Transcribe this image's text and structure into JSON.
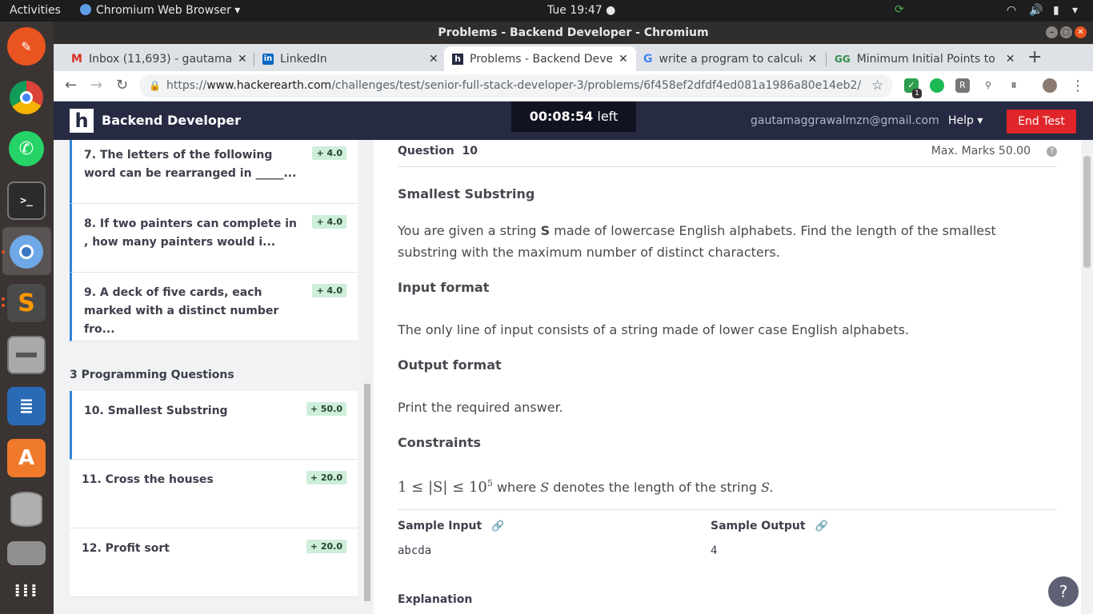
{
  "topbar": {
    "activities": "Activities",
    "app_name": "Chromium Web Browser ▾",
    "clock": "Tue 19:47 ●",
    "tray_menu": "▾"
  },
  "window": {
    "title": "Problems - Backend Developer - Chromium"
  },
  "tabs": [
    {
      "title": "Inbox (11,693) - gautamag",
      "icon": "gmail-icon",
      "close": "✕"
    },
    {
      "title": "LinkedIn",
      "icon": "linkedin-icon",
      "close": "✕"
    },
    {
      "title": "Problems - Backend Devel",
      "icon": "hackerearth-icon",
      "close": "✕"
    },
    {
      "title": "write a program to calcula",
      "icon": "google-icon",
      "close": "✕"
    },
    {
      "title": "Minimum Initial Points to",
      "icon": "gfg-icon",
      "close": "✕"
    }
  ],
  "new_tab": "+",
  "address": {
    "scheme": "https://",
    "host": "www.hackerearth.com",
    "path": "/challenges/test/senior-full-stack-developer-3/problems/6f458ef2dfdf4ed081a1986a80e14eb2/"
  },
  "ext_badge": "1",
  "header": {
    "logo": "h",
    "title": "Backend Developer",
    "timer_value": "00:08:54",
    "timer_suffix": " left",
    "email": "gautamaggrawalmzn@gmail.com",
    "help": "Help ▾",
    "end_test": "End Test"
  },
  "sidebar": {
    "mcq": [
      {
        "text": "7. The letters of the following word can be rearranged in _____...",
        "marks": "+ 4.0"
      },
      {
        "text": "8. If two painters can complete in , how many painters would i...",
        "marks": "+ 4.0"
      },
      {
        "text": "9. A deck of five cards, each marked with a distinct number fro...",
        "marks": "+ 4.0"
      }
    ],
    "programming_heading": "3 Programming Questions",
    "programming": [
      {
        "text": "10. Smallest Substring",
        "marks": "+ 50.0"
      },
      {
        "text": "11. Cross the houses",
        "marks": "+ 20.0"
      },
      {
        "text": "12. Profit sort",
        "marks": "+ 20.0"
      }
    ]
  },
  "question": {
    "label": "Question",
    "number": "10",
    "max_marks": "Max. Marks 50.00",
    "title": "Smallest Substring",
    "statement_1": "You are given a string ",
    "statement_var": "S",
    "statement_2": " made of lowercase English alphabets. Find the length of the smallest substring with the maximum number of distinct characters.",
    "input_heading": "Input format",
    "input_text": "The only line of input consists of a string made of lower case English alphabets.",
    "output_heading": "Output format",
    "output_text": "Print the required answer.",
    "constraints_heading": "Constraints",
    "constraint_math_lhs": "1 ≤ |S| ≤ 10",
    "constraint_math_exp": "5",
    "constraint_text_1": " where ",
    "constraint_var_1": "S",
    "constraint_text_2": " denotes the length of the string ",
    "constraint_var_2": "S.",
    "sample_input_label": "Sample Input",
    "sample_output_label": "Sample Output",
    "sample_input": "abcda",
    "sample_output": "4",
    "explanation_heading": "Explanation"
  }
}
